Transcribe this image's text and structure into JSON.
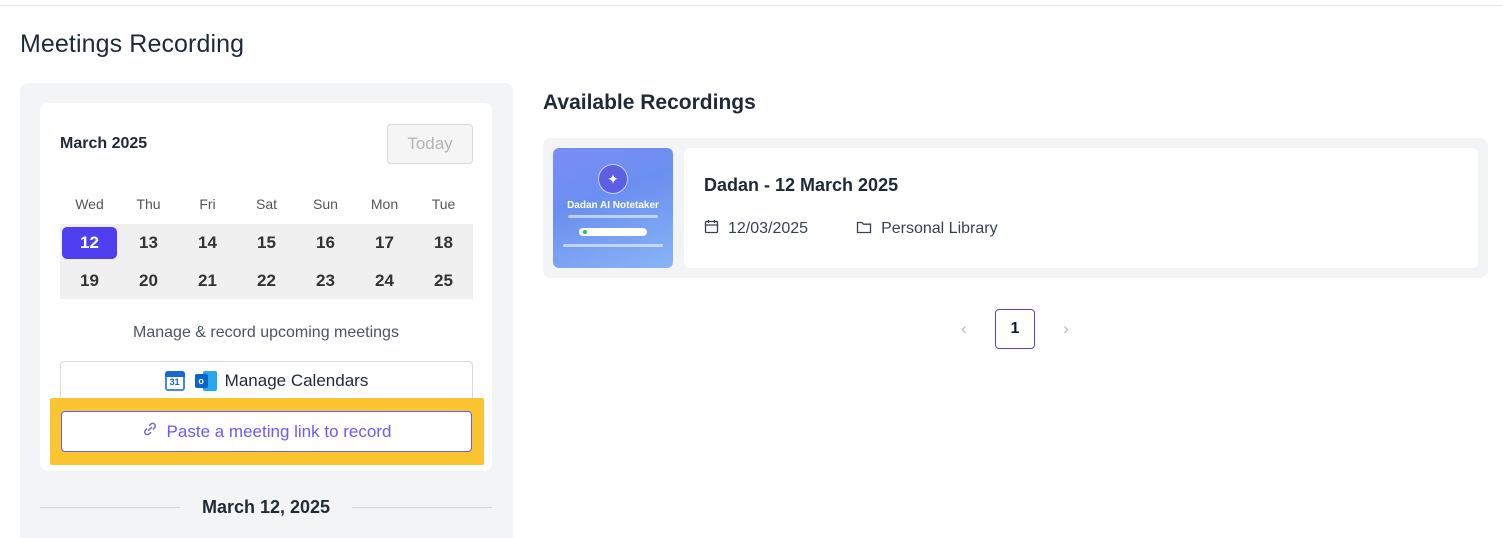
{
  "page": {
    "title": "Meetings Recording"
  },
  "calendar": {
    "month_label": "March 2025",
    "today_label": "Today",
    "weekdays": [
      "Wed",
      "Thu",
      "Fri",
      "Sat",
      "Sun",
      "Mon",
      "Tue"
    ],
    "weeks": [
      [
        "12",
        "13",
        "14",
        "15",
        "16",
        "17",
        "18"
      ],
      [
        "19",
        "20",
        "21",
        "22",
        "23",
        "24",
        "25"
      ]
    ],
    "selected_date": "12",
    "manage_text": "Manage & record upcoming meetings",
    "manage_calendars_label": "Manage Calendars",
    "google_calendar_day": "31",
    "outlook_letter": "o",
    "paste_link_label": "Paste a meeting link to record",
    "selected_full_date": "March 12, 2025"
  },
  "recordings": {
    "section_title": "Available Recordings",
    "items": [
      {
        "title": "Dadan - 12 March 2025",
        "date": "12/03/2025",
        "library": "Personal Library",
        "thumbnail_title": "Dadan AI Notetaker"
      }
    ]
  },
  "pagination": {
    "current_page": "1",
    "prev_icon": "chevron-left-icon",
    "next_icon": "chevron-right-icon"
  },
  "colors": {
    "accent": "#4f3ff0",
    "highlight": "#fbc531",
    "link": "#6b5bf2"
  }
}
